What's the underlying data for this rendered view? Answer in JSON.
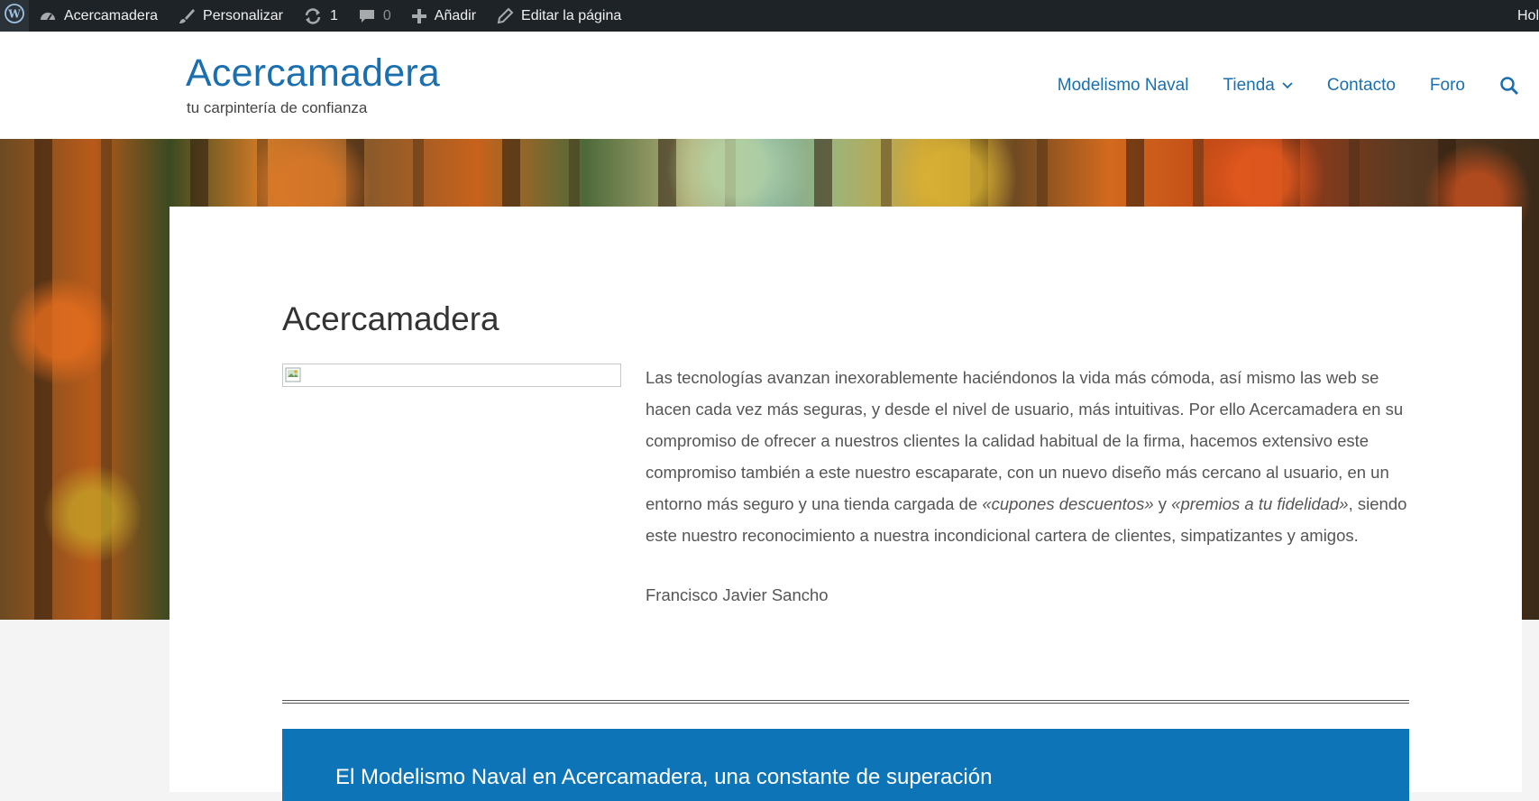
{
  "adminbar": {
    "site_name": "Acercamadera",
    "customize": "Personalizar",
    "updates_count": "1",
    "comments_count": "0",
    "add_new": "Añadir",
    "edit_page": "Editar la página",
    "greeting": "Hol"
  },
  "header": {
    "site_title": "Acercamadera",
    "tagline": "tu carpintería de confianza",
    "nav": [
      {
        "label": "Modelismo Naval"
      },
      {
        "label": "Tienda"
      },
      {
        "label": "Contacto"
      },
      {
        "label": "Foro"
      }
    ],
    "search_icon": "search-icon"
  },
  "content": {
    "page_title": "Acercamadera",
    "intro_part1": "Las tecnologías avanzan inexorablemente haciéndonos la vida más cómoda, así mismo las web se hacen cada vez más seguras, y desde el nivel de usuario, más intuitivas. Por ello Acercamadera en su compromiso de ofrecer a nuestros clientes la calidad habitual de la firma, hacemos extensivo este compromiso también a este nuestro escaparate, con un nuevo diseño más cercano al usuario, en un entorno más seguro y una tienda cargada de ",
    "intro_em1": "«cupones descuentos»",
    "intro_mid": " y ",
    "intro_em2": "«premios a tu fidelidad»",
    "intro_part2": ", siendo este nuestro reconocimiento a nuestra incondicional cartera de clientes, simpatizantes y amigos.",
    "signature": "Francisco Javier Sancho",
    "band_title": "El Modelismo Naval en Acercamadera, una constante de superación"
  },
  "colors": {
    "accent": "#1b6faf",
    "adminbar_bg": "#1d2327",
    "band_bg": "#0e74b8"
  }
}
